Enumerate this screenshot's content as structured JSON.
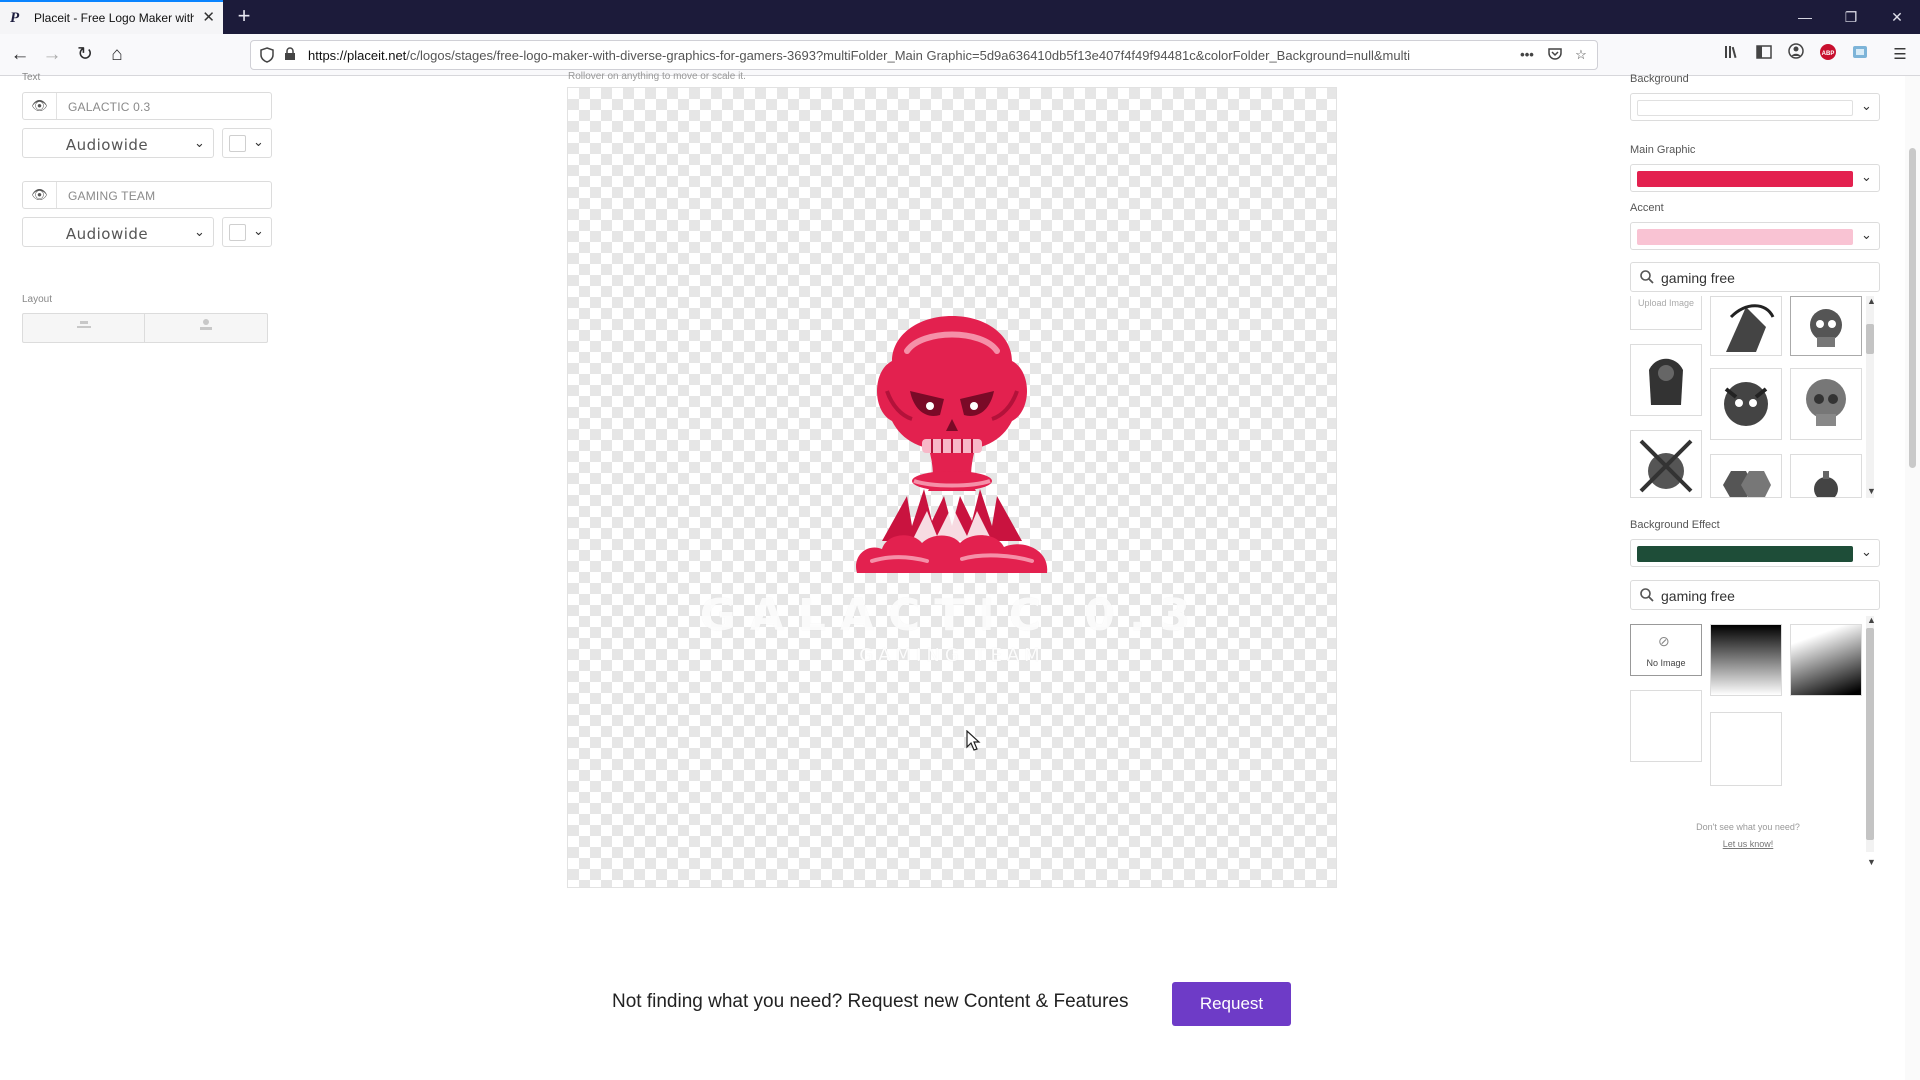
{
  "browser": {
    "tab_title": "Placeit - Free Logo Maker with",
    "favicon_letter": "P",
    "url_host": "https://placeit.net",
    "url_path": "/c/logos/stages/free-logo-maker-with-diverse-graphics-for-gamers-3693?multiFolder_Main Graphic=5d9a636410db5f13e407f4f49f94481c&colorFolder_Background=null&multi",
    "icons": [
      "back-icon",
      "forward-icon",
      "reload-icon",
      "home-icon",
      "shield-icon",
      "lock-icon",
      "more-icon",
      "pocket-icon",
      "star-icon",
      "library-icon",
      "sidebar-icon",
      "account-icon",
      "adblock-icon",
      "extension-icon",
      "menu-icon"
    ]
  },
  "left_panel": {
    "section_label": "Text",
    "text_items": [
      {
        "value": "GALACTIC 0.3",
        "font": "Audiowide"
      },
      {
        "value": "GAMING TEAM",
        "font": "Audiowide"
      }
    ],
    "layout_label": "Layout"
  },
  "canvas": {
    "hint": "Rollover on anything to move or scale it.",
    "logo_title": "GALACTIC 0.3",
    "logo_subtitle": "GAMING TEAM",
    "main_graphic_color": "#e3214f"
  },
  "right_panel": {
    "background_label": "Background",
    "main_graphic_label": "Main Graphic",
    "main_graphic_color": "#e3214f",
    "accent_label": "Accent",
    "accent_color": "#f9c3d3",
    "graphics_search": "gaming free",
    "upload_label": "Upload Image",
    "background_effect_label": "Background Effect",
    "background_effect_color": "#1e4d38",
    "effects_search": "gaming free",
    "no_image_label": "No Image",
    "help_text": "Don't see what you need?",
    "help_link": "Let us know!"
  },
  "footer": {
    "request_text": "Not finding what you need? Request new Content & Features",
    "request_button": "Request",
    "button_color": "#6e3bc7"
  }
}
